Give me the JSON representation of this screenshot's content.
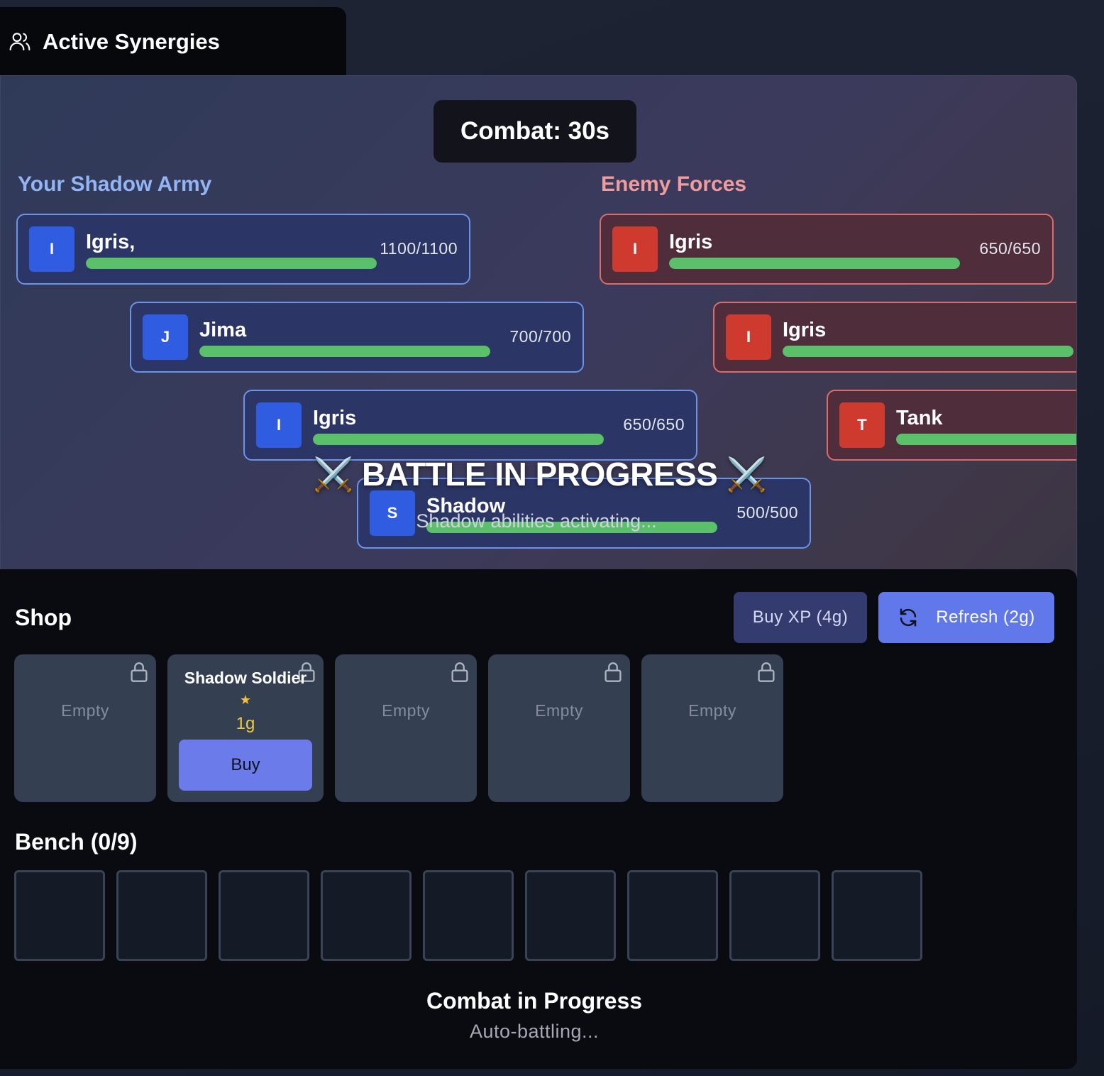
{
  "synergies": {
    "title": "Active Synergies",
    "icon": "users-icon"
  },
  "combat": {
    "timer_label": "Combat: 30s"
  },
  "ally": {
    "title": "Your Shadow Army",
    "units": [
      {
        "initial": "I",
        "name": "Igris,",
        "hp": "1100/1100",
        "hp_fraction": 1.0
      },
      {
        "initial": "J",
        "name": "Jima",
        "hp": "700/700",
        "hp_fraction": 1.0
      },
      {
        "initial": "I",
        "name": "Igris",
        "hp": "650/650",
        "hp_fraction": 1.0
      },
      {
        "initial": "S",
        "name": "Shadow",
        "hp": "500/500",
        "hp_fraction": 1.0
      }
    ]
  },
  "enemy": {
    "title": "Enemy Forces",
    "units": [
      {
        "initial": "I",
        "name": "Igris",
        "hp": "650/650",
        "hp_fraction": 1.0
      },
      {
        "initial": "I",
        "name": "Igris",
        "hp": "",
        "hp_fraction": 1.0
      },
      {
        "initial": "T",
        "name": "Tank",
        "hp": "",
        "hp_fraction": 1.0
      }
    ]
  },
  "battle": {
    "banner": "⚔️ BATTLE IN PROGRESS ⚔️",
    "subtitle": "Shadow abilities activating..."
  },
  "shop": {
    "title": "Shop",
    "buy_xp_label": "Buy XP (4g)",
    "refresh_label": "Refresh (2g)",
    "empty_label": "Empty",
    "slots": [
      {
        "empty": true,
        "label": "Empty"
      },
      {
        "empty": false,
        "name": "Shadow Soldier",
        "stars": "★",
        "cost": "1g",
        "buy_label": "Buy"
      },
      {
        "empty": true,
        "label": "Empty"
      },
      {
        "empty": true,
        "label": "Empty"
      },
      {
        "empty": true,
        "label": "Empty"
      }
    ]
  },
  "bench": {
    "title": "Bench (0/9)",
    "capacity": 9,
    "count": 0
  },
  "status": {
    "title": "Combat in Progress",
    "subtitle": "Auto-battling..."
  },
  "colors": {
    "ally_accent": "#2f5ce0",
    "enemy_accent": "#cf3a2e",
    "hp_bar": "#5bc06a",
    "primary_button": "#6178ea",
    "gold": "#f0c93e"
  }
}
